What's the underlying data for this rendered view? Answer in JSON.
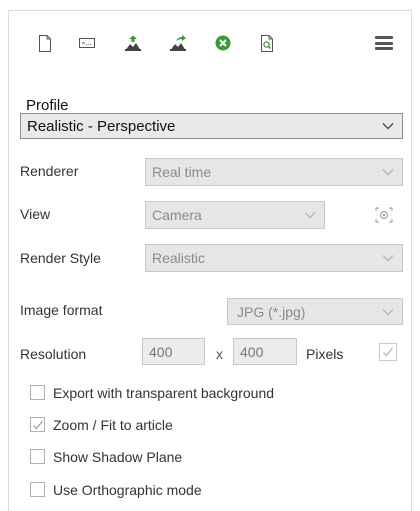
{
  "toolbar": {
    "icons": [
      "new-document-icon",
      "text-field-icon",
      "export-image-icon",
      "share-image-icon",
      "close-circle-icon",
      "document-search-icon"
    ],
    "menu_icon": "hamburger-menu-icon"
  },
  "profile": {
    "label": "Profile",
    "value": "Realistic - Perspective"
  },
  "renderer": {
    "label": "Renderer",
    "value": "Real time"
  },
  "view": {
    "label": "View",
    "value": "Camera",
    "camera_icon": "camera-target-icon"
  },
  "render_style": {
    "label": "Render Style",
    "value": "Realistic"
  },
  "image_format": {
    "label": "Image format",
    "value": "JPG (*.jpg)"
  },
  "resolution": {
    "label": "Resolution",
    "width": "400",
    "separator": "x",
    "height": "400",
    "unit": "Pixels"
  },
  "options": [
    {
      "label": "Export with transparent background",
      "checked": false
    },
    {
      "label": "Zoom / Fit to article",
      "checked": true
    },
    {
      "label": "Show Shadow Plane",
      "checked": false
    },
    {
      "label": "Use Orthographic mode",
      "checked": false
    }
  ],
  "colors": {
    "accent_green": "#3a9a3a",
    "icon_gray": "#666666",
    "check_gray": "#9a9a9a"
  }
}
